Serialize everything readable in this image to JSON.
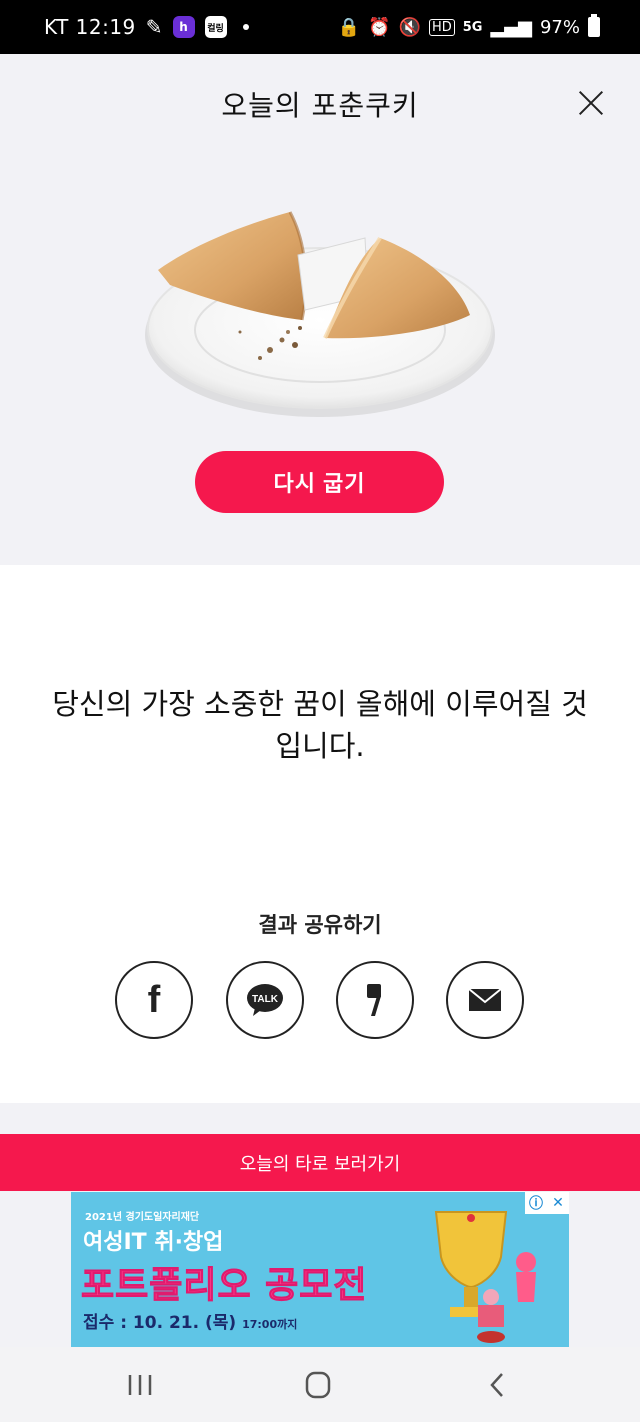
{
  "status_bar": {
    "carrier_time": "KT 12:19",
    "app_icon_1": "h",
    "app_icon_2": "컬링",
    "hd_label": "HD",
    "network": "5G",
    "battery": "97%"
  },
  "header": {
    "title": "오늘의 포춘쿠키",
    "close_icon": "close-icon"
  },
  "bake_again_label": "다시 굽기",
  "fortune_text": "당신의 가장 소중한 꿈이 올해에 이루어질 것입니다.",
  "share": {
    "label": "결과 공유하기",
    "buttons": [
      {
        "name": "facebook",
        "icon": "facebook-icon",
        "text": "f"
      },
      {
        "name": "kakaotalk",
        "icon": "kakaotalk-icon",
        "text": "TALK"
      },
      {
        "name": "kakaostory",
        "icon": "kakaostory-icon",
        "text": ","
      },
      {
        "name": "email",
        "icon": "mail-icon",
        "text": ""
      }
    ]
  },
  "tarot_link": "오늘의 타로 보러가기",
  "ad": {
    "sponsor": "2021년 경기도일자리재단",
    "headline": "여성IT 취·창업",
    "title": "포트폴리오 공모전",
    "date_label": "접수 : 10. 21. (목)",
    "date_time": "17:00까지",
    "info_badge": "ⓘ",
    "close_badge": "✕"
  },
  "colors": {
    "accent": "#f5184d",
    "ad_background": "#5fc5e6",
    "ad_title": "#ff3c8a"
  }
}
